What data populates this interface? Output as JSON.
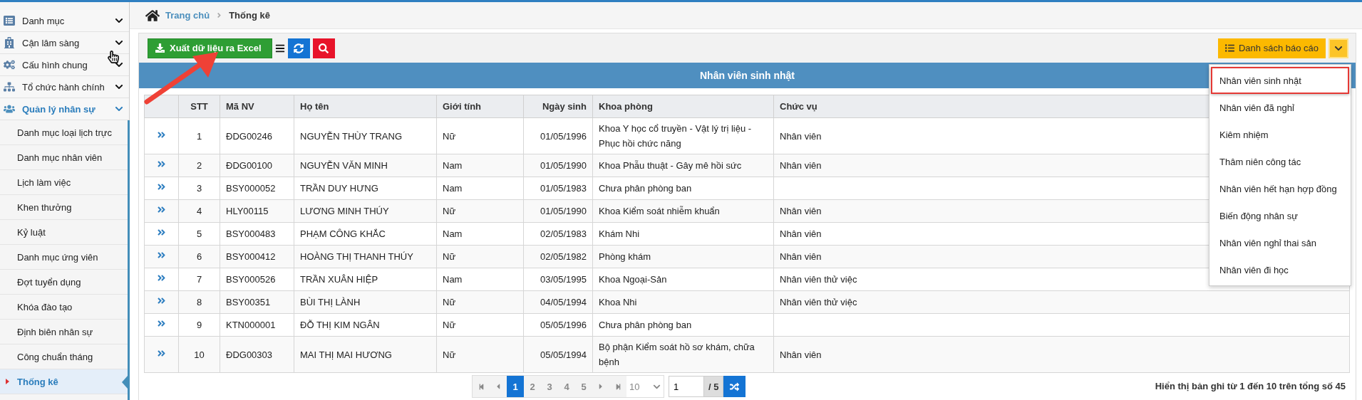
{
  "sidebar": {
    "groups": [
      {
        "label": "Danh mục",
        "expanded": false
      },
      {
        "label": "Cận lâm sàng",
        "expanded": false
      },
      {
        "label": "Cấu hình chung",
        "expanded": false
      },
      {
        "label": "Tổ chức hành chính",
        "expanded": false
      },
      {
        "label": "Quản lý nhân sự",
        "expanded": true,
        "children": [
          {
            "label": "Danh mục loại lịch trực",
            "selected": false
          },
          {
            "label": "Danh mục nhân viên",
            "selected": false
          },
          {
            "label": "Lịch làm việc",
            "selected": false
          },
          {
            "label": "Khen thưởng",
            "selected": false
          },
          {
            "label": "Kỷ luật",
            "selected": false
          },
          {
            "label": "Danh mục ứng viên",
            "selected": false
          },
          {
            "label": "Đợt tuyển dụng",
            "selected": false
          },
          {
            "label": "Khóa đào tạo",
            "selected": false
          },
          {
            "label": "Định biên nhân sự",
            "selected": false
          },
          {
            "label": "Công chuẩn tháng",
            "selected": false
          },
          {
            "label": "Thống kê",
            "selected": true
          }
        ]
      }
    ]
  },
  "breadcrumb": [
    "Trang chủ",
    "Thống kê"
  ],
  "toolbar": {
    "export_button": "Xuất dữ liệu ra Excel"
  },
  "report_menu": {
    "label": "Danh sách báo cáo",
    "expanded": true,
    "items": [
      {
        "label": "Nhân viên sinh nhật",
        "selected": true
      },
      {
        "label": "Nhân viên đã nghỉ",
        "selected": false
      },
      {
        "label": "Kiêm nhiệm",
        "selected": false
      },
      {
        "label": "Thâm niên công tác",
        "selected": false
      },
      {
        "label": "Nhân viên hết hạn hợp đồng",
        "selected": false
      },
      {
        "label": "Biến động nhân sự",
        "selected": false
      },
      {
        "label": "Nhân viên nghỉ thai sản",
        "selected": false
      },
      {
        "label": "Nhân viên đi học",
        "selected": false
      }
    ]
  },
  "table": {
    "title": "Nhân viên sinh nhật",
    "columns": [
      "STT",
      "Mã NV",
      "Họ tên",
      "Giới tính",
      "Ngày sinh",
      "Khoa phòng",
      "Chức vụ"
    ],
    "rows": [
      {
        "stt": "1",
        "ma_nv": "ĐDG00246",
        "ho_ten": "NGUYỄN THÙY TRANG",
        "gioi_tinh": "Nữ",
        "ngay_sinh": "01/05/1996",
        "khoa_phong": "Khoa Y học cổ truyền - Vật lý trị liệu - Phục hồi chức năng",
        "chuc_vu": "Nhân viên"
      },
      {
        "stt": "2",
        "ma_nv": "ĐDG00100",
        "ho_ten": "NGUYỄN VĂN MINH",
        "gioi_tinh": "Nam",
        "ngay_sinh": "01/05/1990",
        "khoa_phong": "Khoa Phẫu thuật - Gây mê hồi sức",
        "chuc_vu": "Nhân viên"
      },
      {
        "stt": "3",
        "ma_nv": "BSY000052",
        "ho_ten": "TRẦN DUY HƯNG",
        "gioi_tinh": "Nam",
        "ngay_sinh": "01/05/1983",
        "khoa_phong": "Chưa phân phòng ban"
      },
      {
        "stt": "4",
        "ma_nv": "HLY00115",
        "ho_ten": "LƯƠNG MINH THÚY",
        "gioi_tinh": "Nữ",
        "ngay_sinh": "01/05/1990",
        "khoa_phong": "Khoa Kiểm soát nhiễm khuẩn",
        "chuc_vu": "Nhân viên"
      },
      {
        "stt": "5",
        "ma_nv": "BSY000483",
        "ho_ten": "PHẠM CÔNG KHẮC",
        "gioi_tinh": "Nam",
        "ngay_sinh": "02/05/1983",
        "khoa_phong": "Khám Nhi",
        "chuc_vu": "Nhân viên"
      },
      {
        "stt": "6",
        "ma_nv": "BSY000412",
        "ho_ten": "HOÀNG THỊ THANH THÚY",
        "gioi_tinh": "Nữ",
        "ngay_sinh": "02/05/1982",
        "khoa_phong": "Phòng khám",
        "chuc_vu": "Nhân viên"
      },
      {
        "stt": "7",
        "ma_nv": "BSY000526",
        "ho_ten": "TRẦN XUÂN HIỆP",
        "gioi_tinh": "Nam",
        "ngay_sinh": "03/05/1995",
        "khoa_phong": "Khoa Ngoại-Sản",
        "chuc_vu": "Nhân viên thử việc"
      },
      {
        "stt": "8",
        "ma_nv": "BSY00351",
        "ho_ten": "BÙI THỊ LÀNH",
        "gioi_tinh": "Nữ",
        "ngay_sinh": "04/05/1994",
        "khoa_phong": "Khoa Nhi",
        "chuc_vu": "Nhân viên thử việc"
      },
      {
        "stt": "9",
        "ma_nv": "KTN000001",
        "ho_ten": "ĐỖ THỊ KIM NGÂN",
        "gioi_tinh": "Nữ",
        "ngay_sinh": "05/05/1996",
        "khoa_phong": "Chưa phân phòng ban"
      },
      {
        "stt": "10",
        "ma_nv": "ĐDG00303",
        "ho_ten": "MAI THỊ MAI HƯƠNG",
        "gioi_tinh": "Nữ",
        "ngay_sinh": "05/05/1994",
        "khoa_phong": "Bộ phận Kiểm soát hồ sơ khám, chữa bệnh",
        "chuc_vu": "Nhân viên"
      }
    ]
  },
  "pagination": {
    "pages": [
      {
        "label": "1",
        "selected": true
      },
      {
        "label": "2",
        "selected": false
      },
      {
        "label": "3",
        "selected": false
      },
      {
        "label": "4",
        "selected": false
      },
      {
        "label": "5",
        "selected": false
      }
    ],
    "page_size": "10",
    "page_input": "1",
    "page_total": "/ 5",
    "summary": "Hiển thị bản ghi từ 1 đến 10 trên tổng số 45"
  }
}
